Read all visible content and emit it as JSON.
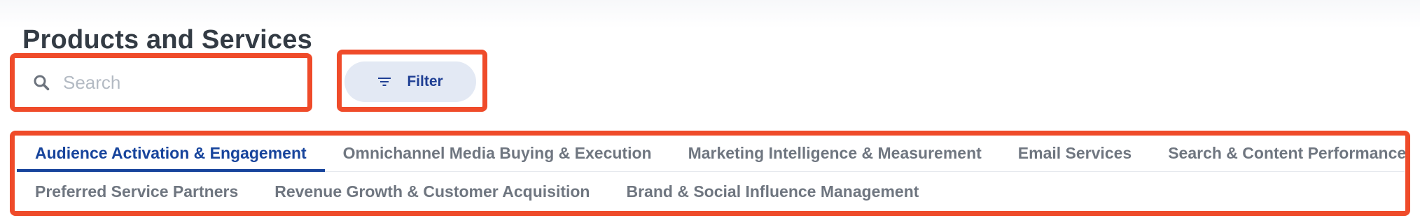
{
  "page": {
    "title": "Products and Services"
  },
  "search": {
    "placeholder": "Search",
    "value": "",
    "icon": "search-icon"
  },
  "filter": {
    "label": "Filter",
    "icon": "filter-icon"
  },
  "tabs": {
    "row1": [
      {
        "label": "Audience Activation & Engagement",
        "active": true
      },
      {
        "label": "Omnichannel Media Buying & Execution",
        "active": false
      },
      {
        "label": "Marketing Intelligence & Measurement",
        "active": false
      },
      {
        "label": "Email Services",
        "active": false
      },
      {
        "label": "Search & Content Performance",
        "active": false
      }
    ],
    "row2": [
      {
        "label": "Preferred Service Partners",
        "active": false
      },
      {
        "label": "Revenue Growth & Customer Acquisition",
        "active": false
      },
      {
        "label": "Brand & Social Influence Management",
        "active": false
      }
    ]
  },
  "colors": {
    "accent": "#17449c",
    "highlight": "#ef4b2a",
    "filter_bg": "#e3e9f4"
  }
}
